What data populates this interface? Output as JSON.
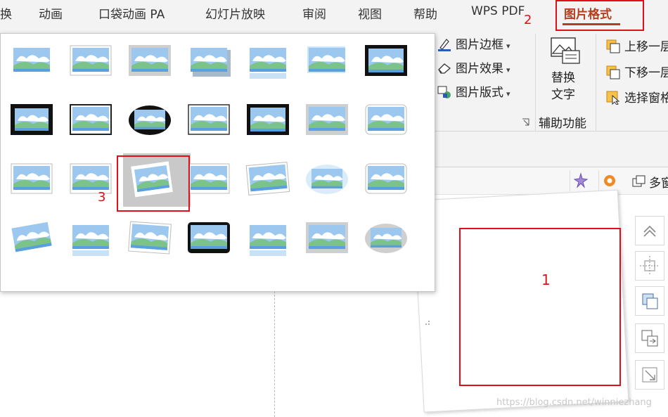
{
  "tabs": [
    {
      "label": "换"
    },
    {
      "label": "动画"
    },
    {
      "label": "口袋动画 PA"
    },
    {
      "label": "幻灯片放映"
    },
    {
      "label": "审阅"
    },
    {
      "label": "视图"
    },
    {
      "label": "帮助"
    },
    {
      "label": "WPS PDF"
    },
    {
      "label": "图片格式",
      "active": true
    }
  ],
  "ribbon": {
    "picture_border": "图片边框",
    "picture_effects": "图片效果",
    "picture_layout": "图片版式",
    "alt_text_line1": "替换",
    "alt_text_line2": "文字",
    "accessibility_group": "辅助功能",
    "bring_forward": "上移一层",
    "send_backward": "下移一层",
    "selection_pane": "选择窗格"
  },
  "multi_window_label": "多窗",
  "annotations": {
    "one": "1",
    "two": "2",
    "three": "3"
  },
  "accent_color": "#b83c1e",
  "annotation_color": "#e0101a",
  "gallery": {
    "rows": 4,
    "columns": 7,
    "selected_style": "row 3, column 3 (rotated white frame)"
  },
  "watermark": "https://blog.csdn.net/winniezhang"
}
